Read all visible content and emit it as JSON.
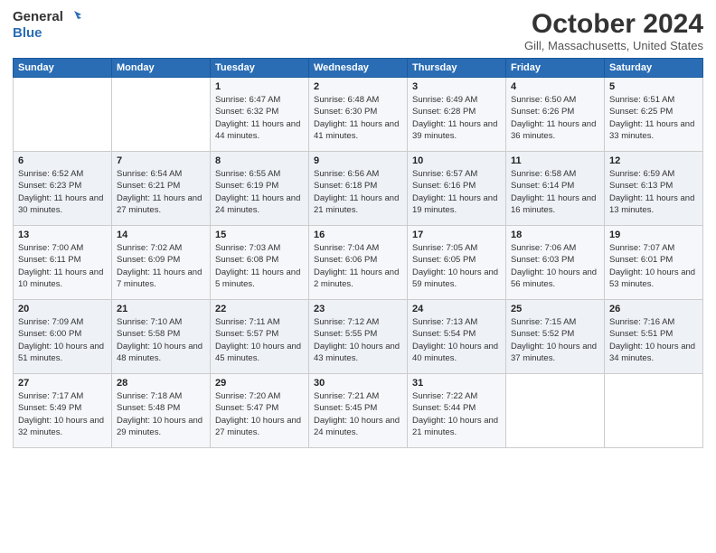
{
  "logo": {
    "line1": "General",
    "line2": "Blue"
  },
  "title": "October 2024",
  "location": "Gill, Massachusetts, United States",
  "days_of_week": [
    "Sunday",
    "Monday",
    "Tuesday",
    "Wednesday",
    "Thursday",
    "Friday",
    "Saturday"
  ],
  "weeks": [
    [
      {
        "day": "",
        "info": ""
      },
      {
        "day": "",
        "info": ""
      },
      {
        "day": "1",
        "info": "Sunrise: 6:47 AM\nSunset: 6:32 PM\nDaylight: 11 hours and 44 minutes."
      },
      {
        "day": "2",
        "info": "Sunrise: 6:48 AM\nSunset: 6:30 PM\nDaylight: 11 hours and 41 minutes."
      },
      {
        "day": "3",
        "info": "Sunrise: 6:49 AM\nSunset: 6:28 PM\nDaylight: 11 hours and 39 minutes."
      },
      {
        "day": "4",
        "info": "Sunrise: 6:50 AM\nSunset: 6:26 PM\nDaylight: 11 hours and 36 minutes."
      },
      {
        "day": "5",
        "info": "Sunrise: 6:51 AM\nSunset: 6:25 PM\nDaylight: 11 hours and 33 minutes."
      }
    ],
    [
      {
        "day": "6",
        "info": "Sunrise: 6:52 AM\nSunset: 6:23 PM\nDaylight: 11 hours and 30 minutes."
      },
      {
        "day": "7",
        "info": "Sunrise: 6:54 AM\nSunset: 6:21 PM\nDaylight: 11 hours and 27 minutes."
      },
      {
        "day": "8",
        "info": "Sunrise: 6:55 AM\nSunset: 6:19 PM\nDaylight: 11 hours and 24 minutes."
      },
      {
        "day": "9",
        "info": "Sunrise: 6:56 AM\nSunset: 6:18 PM\nDaylight: 11 hours and 21 minutes."
      },
      {
        "day": "10",
        "info": "Sunrise: 6:57 AM\nSunset: 6:16 PM\nDaylight: 11 hours and 19 minutes."
      },
      {
        "day": "11",
        "info": "Sunrise: 6:58 AM\nSunset: 6:14 PM\nDaylight: 11 hours and 16 minutes."
      },
      {
        "day": "12",
        "info": "Sunrise: 6:59 AM\nSunset: 6:13 PM\nDaylight: 11 hours and 13 minutes."
      }
    ],
    [
      {
        "day": "13",
        "info": "Sunrise: 7:00 AM\nSunset: 6:11 PM\nDaylight: 11 hours and 10 minutes."
      },
      {
        "day": "14",
        "info": "Sunrise: 7:02 AM\nSunset: 6:09 PM\nDaylight: 11 hours and 7 minutes."
      },
      {
        "day": "15",
        "info": "Sunrise: 7:03 AM\nSunset: 6:08 PM\nDaylight: 11 hours and 5 minutes."
      },
      {
        "day": "16",
        "info": "Sunrise: 7:04 AM\nSunset: 6:06 PM\nDaylight: 11 hours and 2 minutes."
      },
      {
        "day": "17",
        "info": "Sunrise: 7:05 AM\nSunset: 6:05 PM\nDaylight: 10 hours and 59 minutes."
      },
      {
        "day": "18",
        "info": "Sunrise: 7:06 AM\nSunset: 6:03 PM\nDaylight: 10 hours and 56 minutes."
      },
      {
        "day": "19",
        "info": "Sunrise: 7:07 AM\nSunset: 6:01 PM\nDaylight: 10 hours and 53 minutes."
      }
    ],
    [
      {
        "day": "20",
        "info": "Sunrise: 7:09 AM\nSunset: 6:00 PM\nDaylight: 10 hours and 51 minutes."
      },
      {
        "day": "21",
        "info": "Sunrise: 7:10 AM\nSunset: 5:58 PM\nDaylight: 10 hours and 48 minutes."
      },
      {
        "day": "22",
        "info": "Sunrise: 7:11 AM\nSunset: 5:57 PM\nDaylight: 10 hours and 45 minutes."
      },
      {
        "day": "23",
        "info": "Sunrise: 7:12 AM\nSunset: 5:55 PM\nDaylight: 10 hours and 43 minutes."
      },
      {
        "day": "24",
        "info": "Sunrise: 7:13 AM\nSunset: 5:54 PM\nDaylight: 10 hours and 40 minutes."
      },
      {
        "day": "25",
        "info": "Sunrise: 7:15 AM\nSunset: 5:52 PM\nDaylight: 10 hours and 37 minutes."
      },
      {
        "day": "26",
        "info": "Sunrise: 7:16 AM\nSunset: 5:51 PM\nDaylight: 10 hours and 34 minutes."
      }
    ],
    [
      {
        "day": "27",
        "info": "Sunrise: 7:17 AM\nSunset: 5:49 PM\nDaylight: 10 hours and 32 minutes."
      },
      {
        "day": "28",
        "info": "Sunrise: 7:18 AM\nSunset: 5:48 PM\nDaylight: 10 hours and 29 minutes."
      },
      {
        "day": "29",
        "info": "Sunrise: 7:20 AM\nSunset: 5:47 PM\nDaylight: 10 hours and 27 minutes."
      },
      {
        "day": "30",
        "info": "Sunrise: 7:21 AM\nSunset: 5:45 PM\nDaylight: 10 hours and 24 minutes."
      },
      {
        "day": "31",
        "info": "Sunrise: 7:22 AM\nSunset: 5:44 PM\nDaylight: 10 hours and 21 minutes."
      },
      {
        "day": "",
        "info": ""
      },
      {
        "day": "",
        "info": ""
      }
    ]
  ]
}
